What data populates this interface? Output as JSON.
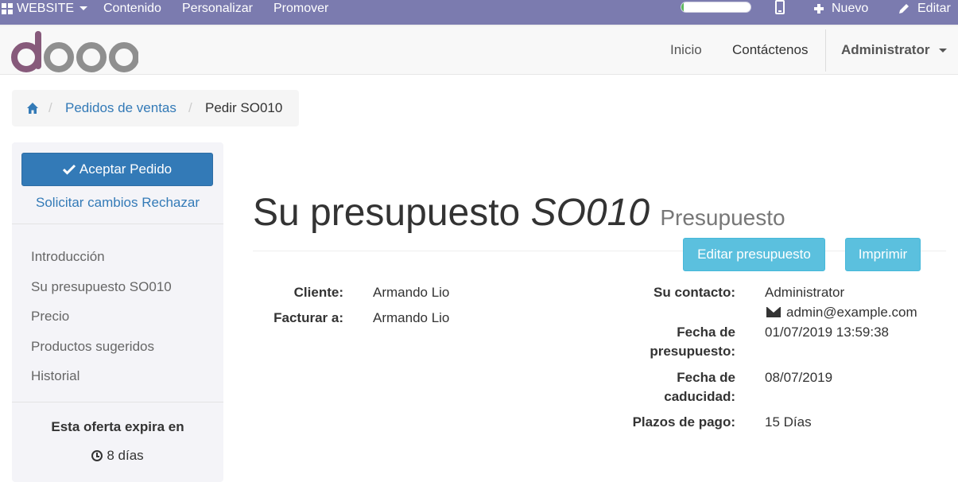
{
  "adminbar": {
    "website_label": "WEBSITE",
    "menu": [
      "Contenido",
      "Personalizar",
      "Promover"
    ],
    "progress_fraction": 0.03,
    "progress_color": "#5cb85c",
    "new_label": "Nuevo",
    "edit_label": "Editar",
    "background": "#7b7baf"
  },
  "header": {
    "logo_text": "odoo",
    "nav": [
      "Inicio",
      "Contáctenos"
    ],
    "user": "Administrator"
  },
  "breadcrumb": {
    "home_icon": "home-icon",
    "orders": "Pedidos de ventas",
    "current": "Pedir SO010"
  },
  "sidebar": {
    "accept_label": "Aceptar Pedido",
    "changes_label": "Solicitar cambios",
    "reject_label": "Rechazar",
    "toc": [
      "Introducción",
      "Su presupuesto SO010",
      "Precio",
      "Productos sugeridos",
      "Historial"
    ],
    "expire_title": "Esta oferta expira en",
    "expire_days": "8 días"
  },
  "main": {
    "title_prefix": "Su presupuesto",
    "title_ref": "SO010",
    "title_state": "Presupuesto",
    "edit_button": "Editar presupuesto",
    "print_button": "Imprimir"
  },
  "details": {
    "customer_label": "Cliente:",
    "customer": "Armando Lio",
    "invoice_label": "Facturar a:",
    "invoice": "Armando Lio",
    "contact_label": "Su contacto:",
    "contact": "Administrator",
    "contact_email": "admin@example.com",
    "quote_date_label_1": "Fecha de",
    "quote_date_label_2": "presupuesto:",
    "quote_date": "01/07/2019 13:59:38",
    "expiry_label_1": "Fecha de",
    "expiry_label_2": "caducidad:",
    "expiry_date": "08/07/2019",
    "terms_label": "Plazos de pago:",
    "terms": "15 Días"
  },
  "colors": {
    "primary": "#337ab7",
    "info": "#5bc0de",
    "logo_purple": "#875a7b",
    "logo_gray": "#8f8f8f"
  }
}
